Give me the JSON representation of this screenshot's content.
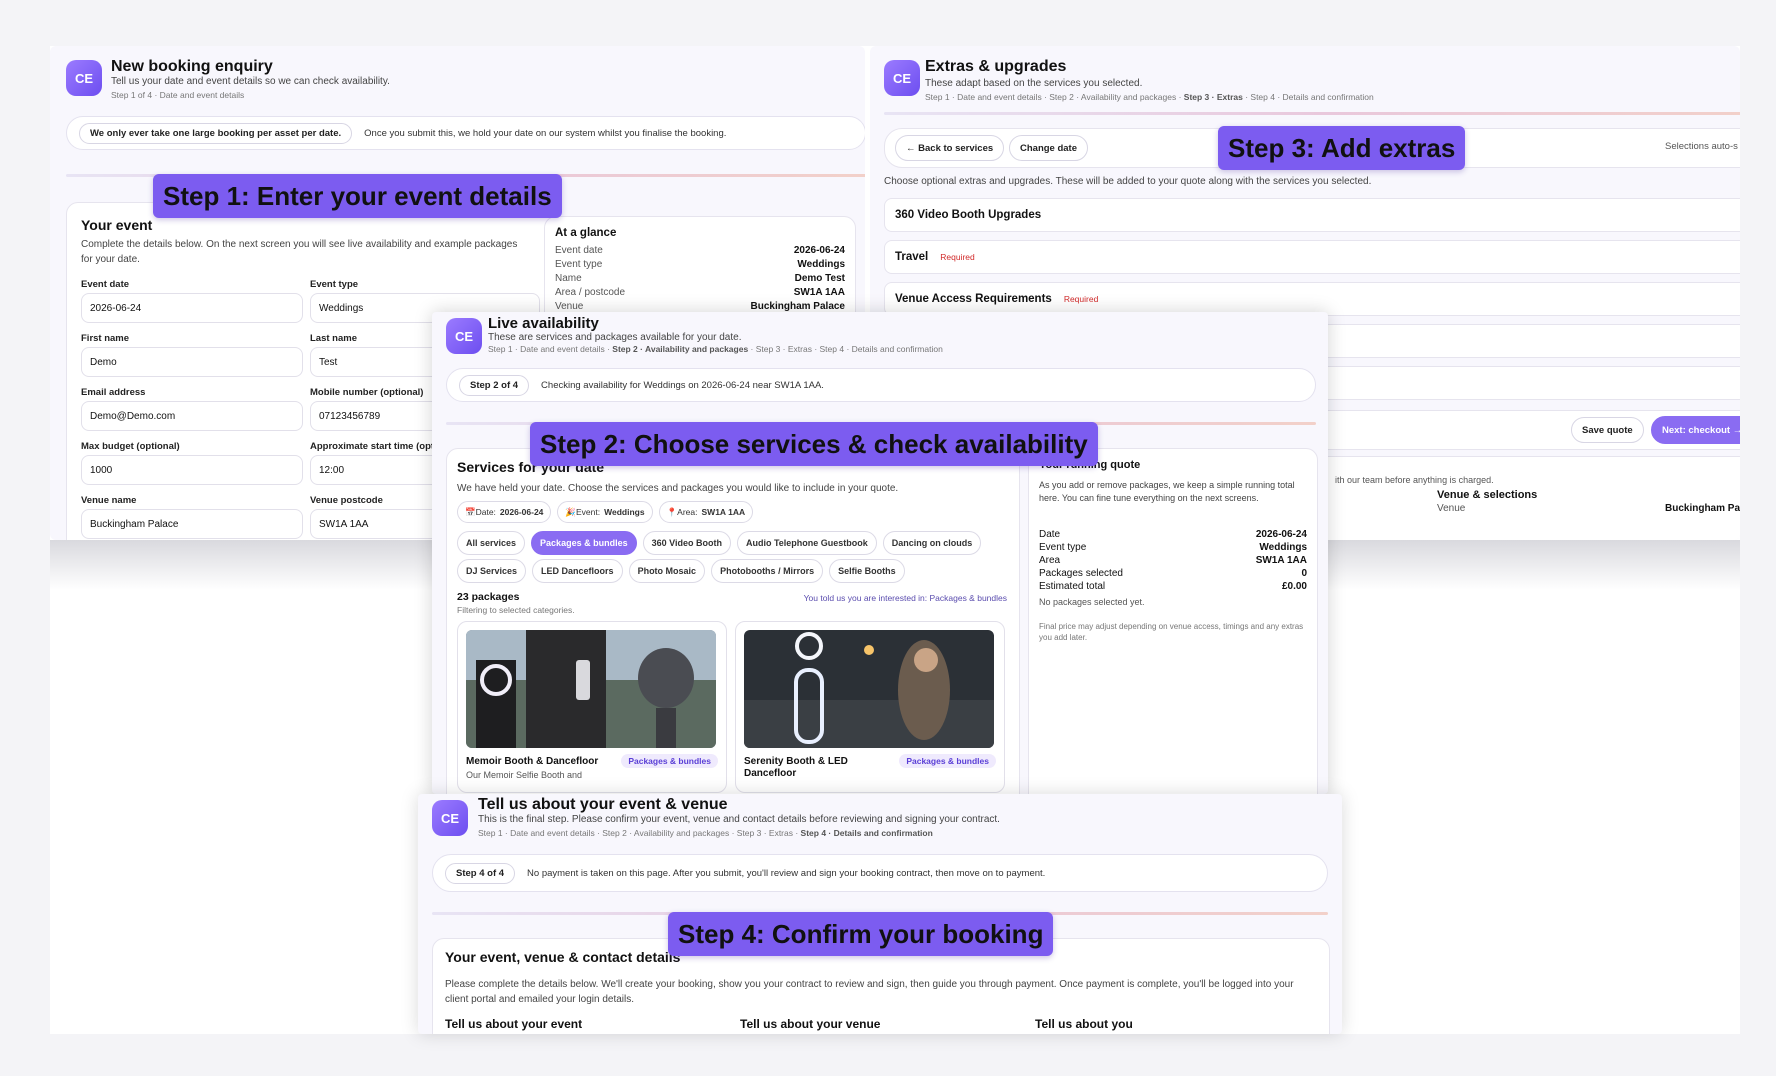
{
  "logo_text": "CE",
  "step1": {
    "title": "New booking enquiry",
    "subtitle": "Tell us your date and event details so we can check availability.",
    "steps": "Step 1 of 4 · Date and event details",
    "notice_pill": "We only ever take one large booking per asset per date.",
    "notice_text": "Once you submit this, we hold your date on our system whilst you finalise the booking.",
    "banner": "Step 1: Enter your event details",
    "card_title": "Your event",
    "card_text": "Complete the details below. On the next screen you will see live availability and example packages for your date.",
    "fields": {
      "event_date": {
        "label": "Event date",
        "value": "2026-06-24"
      },
      "event_type": {
        "label": "Event type",
        "value": "Weddings"
      },
      "first_name": {
        "label": "First name",
        "value": "Demo"
      },
      "last_name": {
        "label": "Last name",
        "value": "Test"
      },
      "email": {
        "label": "Email address",
        "value": "Demo@Demo.com"
      },
      "mobile": {
        "label": "Mobile number (optional)",
        "value": "07123456789"
      },
      "budget": {
        "label": "Max budget (optional)",
        "value": "1000"
      },
      "start_time": {
        "label": "Approximate start time (opt",
        "value": "12:00"
      },
      "venue_name": {
        "label": "Venue name",
        "value": "Buckingham Palace"
      },
      "venue_postcode": {
        "label": "Venue postcode",
        "value": "SW1A 1AA"
      }
    },
    "glance": {
      "title": "At a glance",
      "rows": [
        {
          "k": "Event date",
          "v": "2026-06-24"
        },
        {
          "k": "Event type",
          "v": "Weddings"
        },
        {
          "k": "Name",
          "v": "Demo Test"
        },
        {
          "k": "Area / postcode",
          "v": "SW1A 1AA"
        },
        {
          "k": "Venue",
          "v": "Buckingham Palace"
        }
      ]
    }
  },
  "step3": {
    "title": "Extras & upgrades",
    "subtitle": "These adapt based on the services you selected.",
    "steps_a": "Step 1 · Date and event details · Step 2 · Availability and packages · ",
    "steps_b": "Step 3 · Extras",
    "steps_c": " · Step 4 · Details and confirmation",
    "back_btn": "← Back to services",
    "change_btn": "Change date",
    "autosave": "Selections auto-s",
    "banner": "Step 3: Add extras",
    "intro": "Choose optional extras and upgrades. These will be added to your quote along with the services you selected.",
    "extras": [
      {
        "label": "360 Video Booth Upgrades",
        "required": ""
      },
      {
        "label": "Travel",
        "required": "Required"
      },
      {
        "label": "Venue Access Requirements",
        "required": "Required"
      }
    ],
    "save_btn": "Save quote",
    "next_btn": "Next: checkout →",
    "team_text": "ith our team before anything is charged.",
    "vs_title": "Venue & selections",
    "vs_key": "Venue",
    "vs_val": "Buckingham Pala"
  },
  "step2": {
    "title": "Live availability",
    "subtitle": "These are services and packages available for your date.",
    "steps_a": "Step 1 · Date and event details · ",
    "steps_b": "Step 2 · Availability and packages",
    "steps_c": " · Step 3 · Extras · Step 4 · Details and confirmation",
    "notice_pill": "Step 2 of 4",
    "notice_text": "Checking availability for Weddings on 2026-06-24 near SW1A 1AA.",
    "banner": "Step 2: Choose services & check availability",
    "card_title": "Services for your date",
    "card_text": "We have held your date. Choose the services and packages you would like to include in your quote.",
    "info": [
      {
        "icon": "📅",
        "k": "Date:",
        "v": "2026-06-24"
      },
      {
        "icon": "🎉",
        "k": "Event:",
        "v": "Weddings"
      },
      {
        "icon": "📍",
        "k": "Area:",
        "v": "SW1A 1AA"
      }
    ],
    "categories_row1": [
      "All services",
      "Packages & bundles",
      "360 Video Booth",
      "Audio Telephone Guestbook",
      "Dancing on clouds"
    ],
    "categories_row2": [
      "DJ Services",
      "LED Dancefloors",
      "Photo Mosaic",
      "Photobooths / Mirrors",
      "Selfie Booths"
    ],
    "active_category": "Packages & bundles",
    "count": "23 packages",
    "filter_note": "Filtering to selected categories.",
    "interest": "You told us you are interested in: Packages & bundles",
    "packages": [
      {
        "name": "Memoir Booth & Dancefloor",
        "desc": "Our Memoir Selfie Booth and",
        "tag": "Packages & bundles"
      },
      {
        "name": "Serenity Booth & LED Dancefloor",
        "desc": "",
        "tag": "Packages & bundles"
      }
    ],
    "quote": {
      "title": "Your running quote",
      "text": "As you add or remove packages, we keep a simple running total here. You can fine tune everything on the next screens.",
      "rows": [
        {
          "k": "Date",
          "v": "2026-06-24"
        },
        {
          "k": "Event type",
          "v": "Weddings"
        },
        {
          "k": "Area",
          "v": "SW1A 1AA"
        },
        {
          "k": "Packages selected",
          "v": "0"
        },
        {
          "k": "Estimated total",
          "v": "£0.00"
        }
      ],
      "none": "No packages selected yet.",
      "footnote": "Final price may adjust depending on venue access, timings and any extras you add later."
    }
  },
  "step4": {
    "title": "Tell us about your event & venue",
    "subtitle": "This is the final step. Please confirm your event, venue and contact details before reviewing and signing your contract.",
    "steps_a": "Step 1 · Date and event details · Step 2 · Availability and packages · Step 3 · Extras · ",
    "steps_b": "Step 4 · Details and confirmation",
    "notice_pill": "Step 4 of 4",
    "notice_text": "No payment is taken on this page. After you submit, you'll review and sign your booking contract, then move on to payment.",
    "banner": "Step 4: Confirm your booking",
    "card_title": "Your event, venue & contact details",
    "card_text": "Please complete the details below. We'll create your booking, show you your contract to review and sign, then guide you through payment. Once payment is complete, you'll be logged into your client portal and emailed your login details.",
    "col1": "Tell us about your event",
    "col2": "Tell us about your venue",
    "col3": "Tell us about you"
  },
  "colors": {
    "accent": "#7c5cf0",
    "required": "#d12a2a",
    "tag_bg": "#efeafd"
  }
}
